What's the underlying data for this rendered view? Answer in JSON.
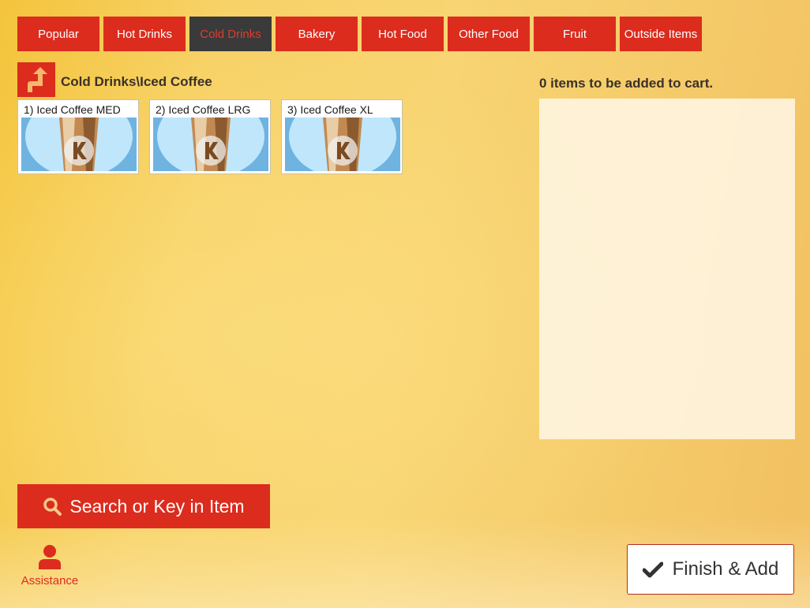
{
  "categories": [
    {
      "label": "Popular"
    },
    {
      "label": "Hot Drinks"
    },
    {
      "label": "Cold Drinks"
    },
    {
      "label": "Bakery"
    },
    {
      "label": "Hot Food"
    },
    {
      "label": "Other Food"
    },
    {
      "label": "Fruit"
    },
    {
      "label": "Outside Items"
    }
  ],
  "active_category": "Cold Drinks",
  "breadcrumb": "Cold Drinks\\Iced Coffee",
  "items": [
    {
      "label": "1) Iced Coffee MED",
      "icon": "iced-coffee-image"
    },
    {
      "label": "2) Iced Coffee LRG",
      "icon": "iced-coffee-image"
    },
    {
      "label": "3) Iced Coffee XL",
      "icon": "iced-coffee-image"
    }
  ],
  "cart": {
    "status": "0 items to be added to cart."
  },
  "search": {
    "label": "Search or Key in Item",
    "icon": "search-icon"
  },
  "assistance": {
    "label": "Assistance",
    "icon": "person-icon"
  },
  "finish": {
    "label": "Finish & Add",
    "icon": "checkmark-icon"
  },
  "colors": {
    "accent": "#dc2c1e",
    "active_tab_bg": "#3a3a3a",
    "background": "#f7d268"
  }
}
